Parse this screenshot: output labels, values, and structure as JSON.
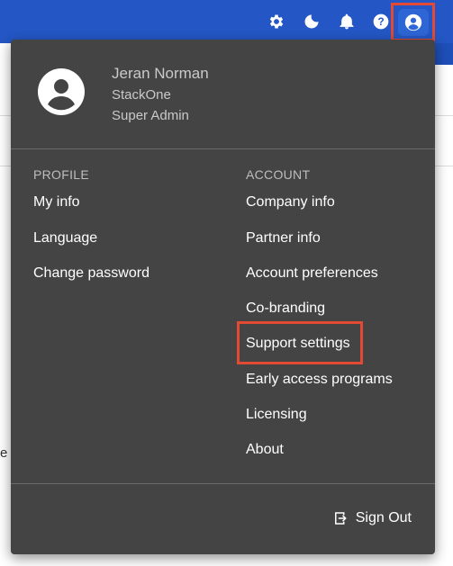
{
  "topbar": {
    "icons": [
      "gear-icon",
      "moon-icon",
      "bell-icon",
      "help-icon",
      "user-circle-icon"
    ],
    "color": "#2457c5",
    "highlight_color": "#e24a33"
  },
  "background_page": {
    "partial_letter": "e"
  },
  "menu": {
    "background": "#444444",
    "user": {
      "name": "Jeran Norman",
      "organization": "StackOne",
      "role": "Super Admin"
    },
    "profile": {
      "title": "PROFILE",
      "items": [
        "My info",
        "Language",
        "Change password"
      ]
    },
    "account": {
      "title": "ACCOUNT",
      "items": [
        "Company info",
        "Partner info",
        "Account preferences",
        "Co-branding",
        "Support settings",
        "Early access programs",
        "Licensing",
        "About"
      ]
    },
    "signout_label": "Sign Out"
  }
}
